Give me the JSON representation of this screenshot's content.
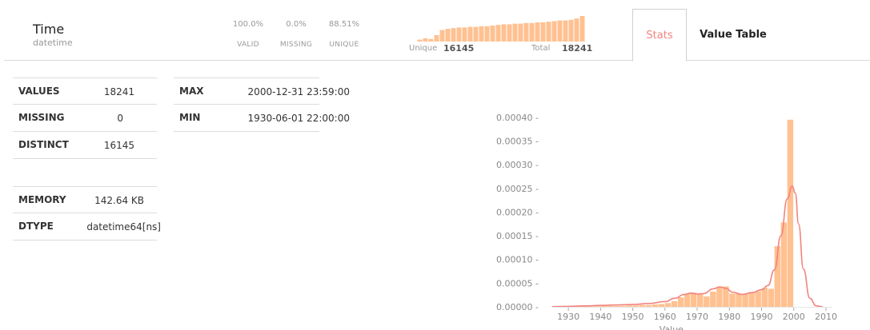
{
  "header": {
    "column_name": "Time",
    "column_dtype": "datetime",
    "valid_pct": "100.0%",
    "missing_pct": "0.0%",
    "unique_pct": "88.51%",
    "valid_label": "VALID",
    "missing_label": "MISSING",
    "unique_label": "UNIQUE",
    "unique_caption": "Unique",
    "unique_count": "16145",
    "total_caption": "Total",
    "total_count": "18241",
    "mini_hist_values": [
      3,
      5,
      4,
      10,
      18,
      20,
      21,
      22,
      22,
      23,
      23,
      24,
      24,
      25,
      26,
      27,
      27,
      28,
      28,
      29,
      29,
      30,
      30,
      31,
      32,
      33,
      33,
      34,
      36,
      40
    ]
  },
  "tabs": {
    "stats": "Stats",
    "value_table": "Value Table"
  },
  "stats": {
    "values_key": "VALUES",
    "values_val": "18241",
    "missing_key": "MISSING",
    "missing_val": "0",
    "distinct_key": "DISTINCT",
    "distinct_val": "16145",
    "memory_key": "MEMORY",
    "memory_val": "142.64 KB",
    "dtype_key": "DTYPE",
    "dtype_val": "datetime64[ns]",
    "max_key": "MAX",
    "max_val": "2000-12-31 23:59:00",
    "min_key": "MIN",
    "min_val": "1930-06-01 22:00:00"
  },
  "colors": {
    "bar": "#ffc191",
    "kde": "#f1847e",
    "accent": "#f1847e"
  },
  "chart_data": {
    "type": "bar",
    "xlabel": "Value",
    "ylabel": "",
    "xlim": [
      1925,
      2012
    ],
    "ylim": [
      0,
      0.00042
    ],
    "x_ticks": [
      1930,
      1940,
      1950,
      1960,
      1970,
      1980,
      1990,
      2000,
      2010
    ],
    "y_ticks": [
      "0.00000",
      "0.00005",
      "0.00010",
      "0.00015",
      "0.00020",
      "0.00025",
      "0.00030",
      "0.00035",
      "0.00040"
    ],
    "bin_width": 2.0,
    "bins": [
      {
        "x": 1930,
        "value": 5e-07
      },
      {
        "x": 1932,
        "value": 1e-06
      },
      {
        "x": 1934,
        "value": 1e-06
      },
      {
        "x": 1936,
        "value": 1e-06
      },
      {
        "x": 1938,
        "value": 1.5e-06
      },
      {
        "x": 1940,
        "value": 2e-06
      },
      {
        "x": 1942,
        "value": 2e-06
      },
      {
        "x": 1944,
        "value": 2e-06
      },
      {
        "x": 1946,
        "value": 2e-06
      },
      {
        "x": 1948,
        "value": 3e-06
      },
      {
        "x": 1950,
        "value": 3e-06
      },
      {
        "x": 1952,
        "value": 4e-06
      },
      {
        "x": 1954,
        "value": 4e-06
      },
      {
        "x": 1956,
        "value": 5e-06
      },
      {
        "x": 1958,
        "value": 6e-06
      },
      {
        "x": 1960,
        "value": 8e-06
      },
      {
        "x": 1962,
        "value": 1.2e-05
      },
      {
        "x": 1964,
        "value": 2e-05
      },
      {
        "x": 1966,
        "value": 2.8e-05
      },
      {
        "x": 1968,
        "value": 3e-05
      },
      {
        "x": 1970,
        "value": 2.7e-05
      },
      {
        "x": 1972,
        "value": 2.2e-05
      },
      {
        "x": 1974,
        "value": 3.2e-05
      },
      {
        "x": 1976,
        "value": 4.2e-05
      },
      {
        "x": 1978,
        "value": 4.3e-05
      },
      {
        "x": 1980,
        "value": 2.8e-05
      },
      {
        "x": 1982,
        "value": 2.8e-05
      },
      {
        "x": 1984,
        "value": 2.8e-05
      },
      {
        "x": 1986,
        "value": 3.1e-05
      },
      {
        "x": 1988,
        "value": 3.3e-05
      },
      {
        "x": 1990,
        "value": 4e-05
      },
      {
        "x": 1992,
        "value": 3.8e-05
      },
      {
        "x": 1994,
        "value": 0.000128
      },
      {
        "x": 1996,
        "value": 0.000178
      },
      {
        "x": 1998,
        "value": 0.000395
      }
    ],
    "kde": [
      [
        1925,
        5e-07
      ],
      [
        1930,
        1e-06
      ],
      [
        1935,
        2e-06
      ],
      [
        1940,
        3e-06
      ],
      [
        1945,
        4e-06
      ],
      [
        1950,
        5e-06
      ],
      [
        1955,
        7e-06
      ],
      [
        1960,
        1.1e-05
      ],
      [
        1963,
        1.8e-05
      ],
      [
        1966,
        2.6e-05
      ],
      [
        1968,
        2.9e-05
      ],
      [
        1970,
        2.7e-05
      ],
      [
        1972,
        2.8e-05
      ],
      [
        1975,
        3.8e-05
      ],
      [
        1977,
        4.2e-05
      ],
      [
        1979,
        3.9e-05
      ],
      [
        1981,
        3.1e-05
      ],
      [
        1984,
        2.6e-05
      ],
      [
        1987,
        3e-05
      ],
      [
        1990,
        3.6e-05
      ],
      [
        1992,
        4.5e-05
      ],
      [
        1994,
        7.8e-05
      ],
      [
        1996,
        0.00015
      ],
      [
        1998,
        0.000228
      ],
      [
        1999.5,
        0.000255
      ],
      [
        2000.5,
        0.00024
      ],
      [
        2001.5,
        0.000175
      ],
      [
        2003,
        8e-05
      ],
      [
        2005,
        1.8e-05
      ],
      [
        2007,
        2e-06
      ],
      [
        2009,
        0.0
      ]
    ]
  }
}
